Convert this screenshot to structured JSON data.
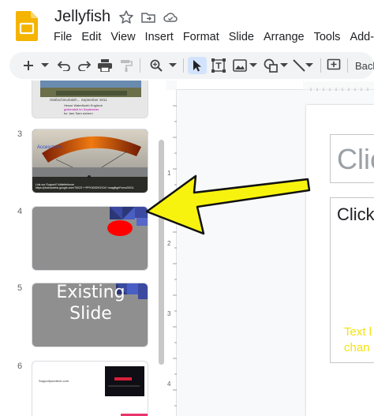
{
  "app": {
    "doc_title": "Jellyfish",
    "logo_icon": "google-slides-logo-icon",
    "accent_color": "#f4b400"
  },
  "menu": [
    "File",
    "Edit",
    "View",
    "Insert",
    "Format",
    "Slide",
    "Arrange",
    "Tools",
    "Add-"
  ],
  "toolbar": {
    "background_label": "Back"
  },
  "filmstrip": {
    "slides": [
      {
        "number": "",
        "caption_line": "Glaßschimuhalsh... September 2011",
        "lines": [
          "Hesse Waterfloeth Englisch",
          "gloltendelt im September",
          "fur Jam Sam sichern"
        ]
      },
      {
        "number": "3",
        "title": "Accesstoins",
        "footer": "Link our Support? Ablieferforum",
        "footer2": "https://photoswebs.google.com/?0023 ++PFK0002K/GC#? nsaglttgeFnmo20011"
      },
      {
        "number": "4"
      },
      {
        "number": "5",
        "text_line1": "Existing",
        "text_line2": "Slide"
      },
      {
        "number": "6",
        "small_text": "Supportyourtech.com"
      }
    ]
  },
  "canvas": {
    "title_placeholder": "Clic",
    "body_placeholder": "Click",
    "hint_line1": "Text l",
    "hint_line2": "chan",
    "hint_color": "#f5e30a"
  },
  "annotation": {
    "arrow_color": "#f8f30e",
    "ellipse_color": "#ff0000",
    "corner_color": "#3b4aa0"
  }
}
